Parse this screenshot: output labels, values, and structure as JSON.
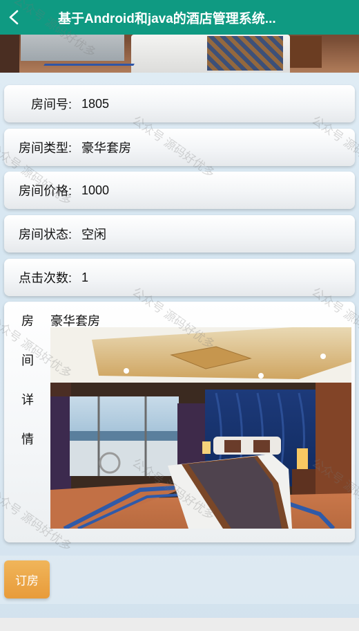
{
  "header": {
    "title": "基于Android和java的酒店管理系统...",
    "back_icon": "chevron-left-icon"
  },
  "room": {
    "number_label": "房间号:",
    "number": "1805",
    "type_label": "房间类型:",
    "type": "豪华套房",
    "price_label": "房间价格:",
    "price": "1000",
    "status_label": "房间状态:",
    "status": "空闲",
    "clicks_label": "点击次数:",
    "clicks": "1"
  },
  "detail": {
    "label_chars": [
      "房",
      "间",
      "详",
      "情"
    ],
    "text": "豪华套房"
  },
  "actions": {
    "book_label": "订房"
  },
  "watermark": {
    "text": "公众号 源码好优多"
  },
  "colors": {
    "header_bg": "#0f9a82",
    "book_button": "#e89b3a"
  }
}
